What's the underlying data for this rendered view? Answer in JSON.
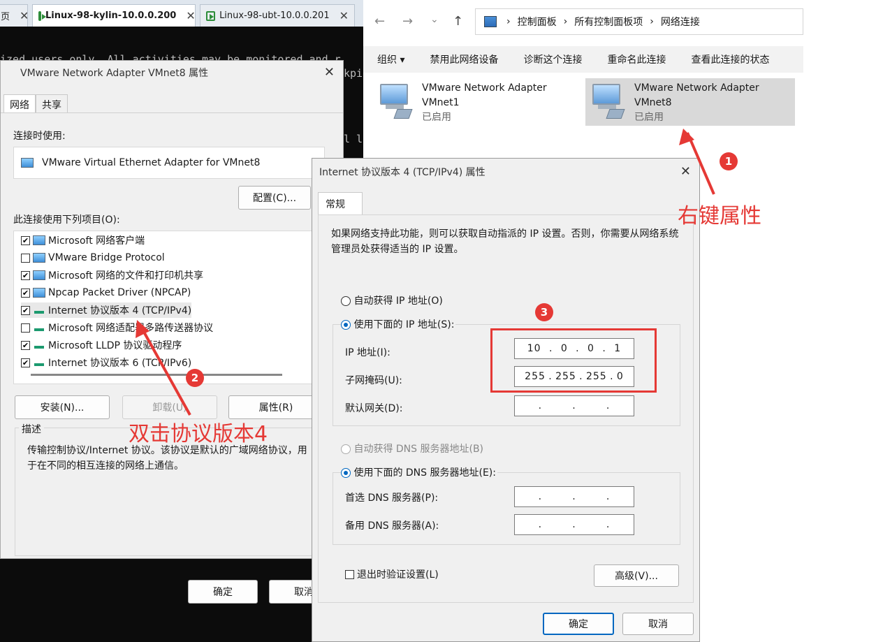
{
  "terminal": {
    "tabs": [
      {
        "label": "页"
      },
      {
        "label": "Linux-98-kylin-10.0.0.200"
      },
      {
        "label": "Linux-98-ubt-10.0.0.201"
      }
    ],
    "close_glyph": "✕",
    "lines": [
      "ized users only. All activities may be monitored and r",
      "kpi",
      "l l"
    ]
  },
  "explorer": {
    "nav": {
      "back": "←",
      "forward": "→",
      "dropdown": "⌄",
      "up": "↑"
    },
    "breadcrumb": [
      "控制面板",
      "所有控制面板项",
      "网络连接"
    ],
    "breadcrumb_sep": "›",
    "commands": [
      "组织 ▾",
      "禁用此网络设备",
      "诊断这个连接",
      "重命名此连接",
      "查看此连接的状态"
    ],
    "adapters": [
      {
        "name": "VMware Network Adapter",
        "sub": "VMnet1",
        "status": "已启用"
      },
      {
        "name": "VMware Network Adapter",
        "sub": "VMnet8",
        "status": "已启用"
      }
    ]
  },
  "dialog_adapter": {
    "title": "VMware Network Adapter VMnet8 属性",
    "close": "✕",
    "tabs": [
      "网络",
      "共享"
    ],
    "connect_using_label": "连接时使用:",
    "adapter_name": "VMware Virtual Ethernet Adapter for VMnet8",
    "configure_button": "配置(C)...",
    "items_label": "此连接使用下列项目(O):",
    "items": [
      {
        "label": "Microsoft 网络客户端",
        "checked": true,
        "icon": "network-icon"
      },
      {
        "label": "VMware Bridge Protocol",
        "checked": false,
        "icon": "network-icon"
      },
      {
        "label": "Microsoft 网络的文件和打印机共享",
        "checked": true,
        "icon": "network-icon"
      },
      {
        "label": "Npcap Packet Driver (NPCAP)",
        "checked": true,
        "icon": "network-icon"
      },
      {
        "label": "Internet 协议版本 4 (TCP/IPv4)",
        "checked": true,
        "icon": "protocol-icon"
      },
      {
        "label": "Microsoft 网络适配器多路传送器协议",
        "checked": false,
        "icon": "protocol-icon"
      },
      {
        "label": "Microsoft LLDP 协议驱动程序",
        "checked": true,
        "icon": "protocol-icon"
      },
      {
        "label": "Internet 协议版本 6 (TCP/IPv6)",
        "checked": true,
        "icon": "protocol-icon"
      }
    ],
    "install_button": "安装(N)...",
    "uninstall_button": "卸载(U)",
    "properties_button": "属性(R)",
    "description_label": "描述",
    "description_text": "传输控制协议/Internet 协议。该协议是默认的广域网络协议，用于在不同的相互连接的网络上通信。",
    "ok_button": "确定",
    "cancel_button": "取消"
  },
  "dialog_ipv4": {
    "title": "Internet 协议版本 4 (TCP/IPv4) 属性",
    "close": "✕",
    "tab": "常规",
    "intro": "如果网络支持此功能，则可以获取自动指派的 IP 设置。否则，你需要从网络系统管理员处获得适当的 IP 设置。",
    "auto_ip_label": "自动获得 IP 地址(O)",
    "manual_ip_label": "使用下面的 IP 地址(S):",
    "ip_label": "IP 地址(I):",
    "ip_value": [
      "10",
      "0",
      "0",
      "1"
    ],
    "mask_label": "子网掩码(U):",
    "mask_value": [
      "255",
      "255",
      "255",
      "0"
    ],
    "gateway_label": "默认网关(D):",
    "gateway_value": [
      "",
      "",
      "",
      ""
    ],
    "auto_dns_label": "自动获得 DNS 服务器地址(B)",
    "manual_dns_label": "使用下面的 DNS 服务器地址(E):",
    "preferred_dns_label": "首选 DNS 服务器(P):",
    "alternate_dns_label": "备用 DNS 服务器(A):",
    "validate_label": "退出时验证设置(L)",
    "advanced_button": "高级(V)...",
    "ok_button": "确定",
    "cancel_button": "取消"
  },
  "annotations": {
    "badge1": "1",
    "badge2": "2",
    "badge3": "3",
    "step1": "右键属性",
    "step2": "双击协议版本4",
    "color": "#e53935"
  }
}
